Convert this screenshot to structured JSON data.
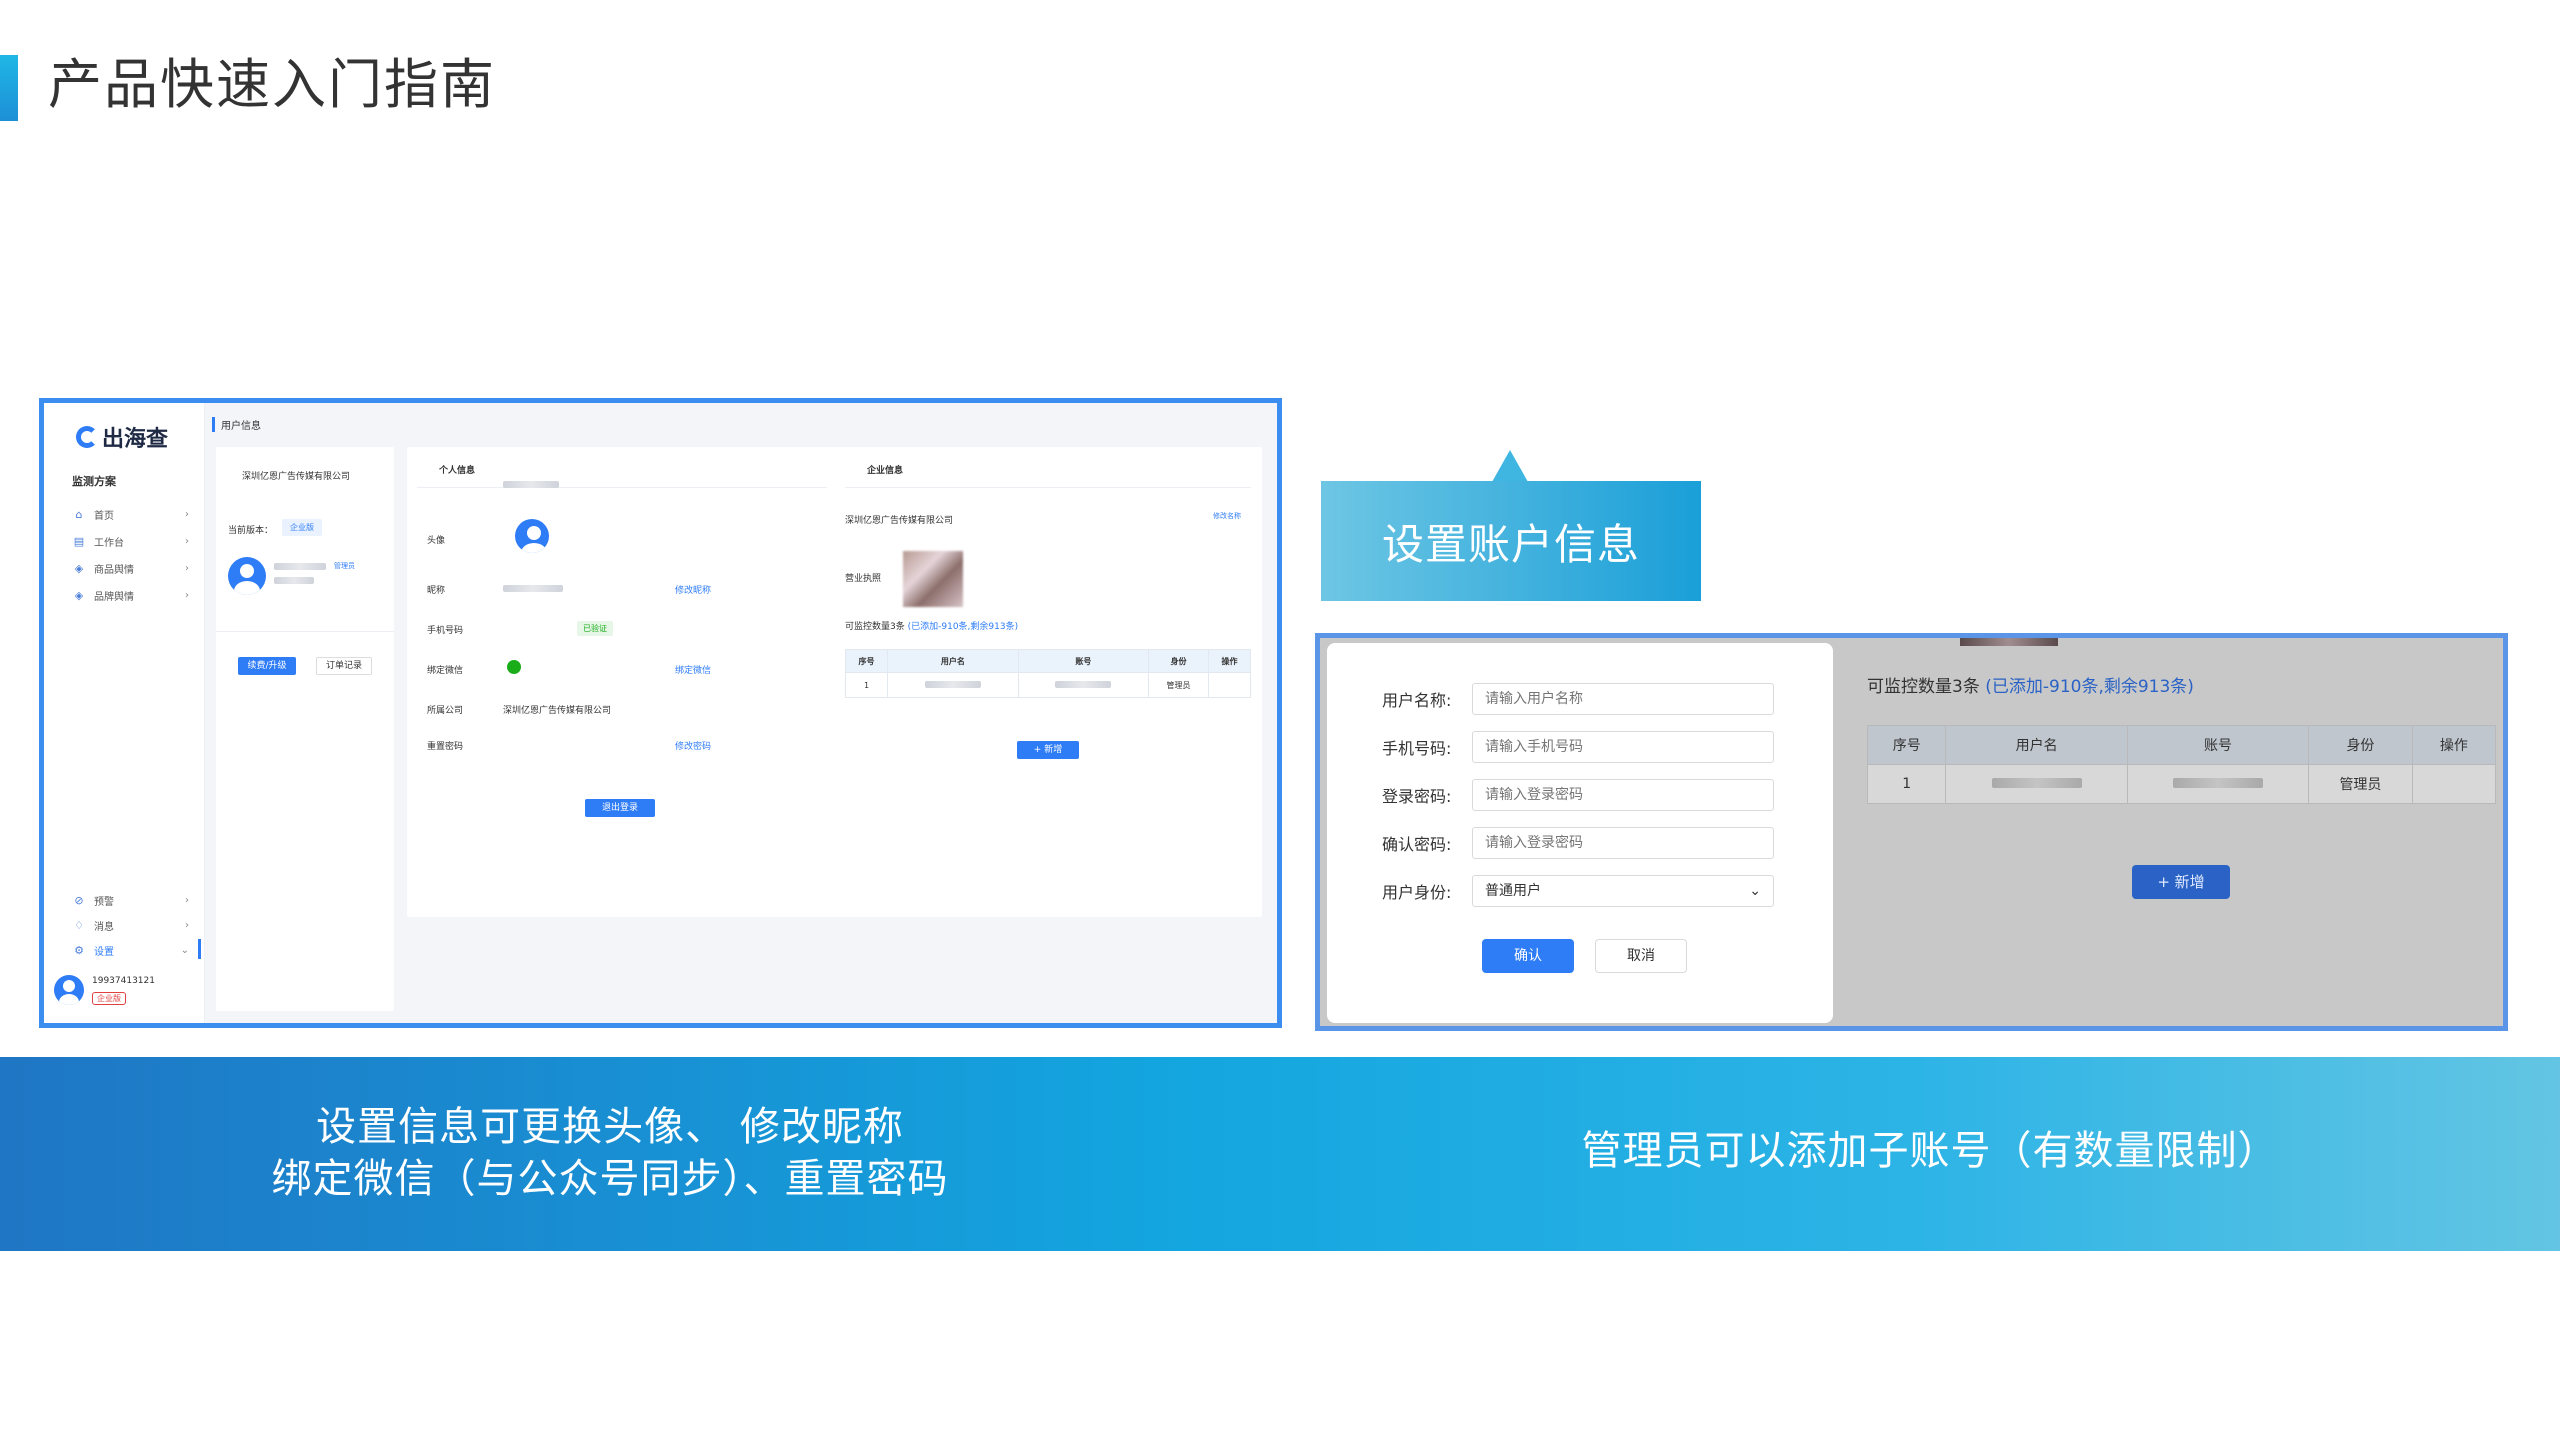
{
  "slide": {
    "title": "产品快速入门指南",
    "callout": "设置账户信息",
    "caption_left_line1": "设置信息可更换头像、 修改昵称",
    "caption_left_line2": "绑定微信（与公众号同步）、重置密码",
    "caption_right": "管理员可以添加子账号（有数量限制）"
  },
  "left_screenshot": {
    "logo_text": "出海查",
    "sidebar": {
      "section": "监测方案",
      "items": [
        {
          "label": "首页",
          "icon": "home-icon"
        },
        {
          "label": "工作台",
          "icon": "workbench-icon"
        },
        {
          "label": "商品舆情",
          "icon": "layers-icon"
        },
        {
          "label": "品牌舆情",
          "icon": "layers-icon"
        }
      ],
      "bottom_items": [
        {
          "label": "预警",
          "icon": "alarm-icon"
        },
        {
          "label": "消息",
          "icon": "bell-icon"
        },
        {
          "label": "设置",
          "icon": "gear-icon"
        }
      ],
      "user_phone": "19937413121",
      "user_tag": "企业版"
    },
    "breadcrumb": "用户信息",
    "account_card": {
      "company": "深圳亿恩广告传媒有限公司",
      "version_label": "当前版本：",
      "version_value": "企业版",
      "role_badge": "管理员",
      "renew_button": "续费/升级",
      "orders_button": "订单记录"
    },
    "personal": {
      "heading": "个人信息",
      "avatar_label": "头像",
      "nickname_label": "昵称",
      "nickname_action": "修改昵称",
      "phone_label": "手机号码",
      "phone_status": "已验证",
      "wechat_label": "绑定微信",
      "wechat_action": "绑定微信",
      "company_label": "所属公司",
      "company_value": "深圳亿恩广告传媒有限公司",
      "password_label": "重置密码",
      "password_action": "修改密码",
      "logout_button": "退出登录"
    },
    "enterprise": {
      "heading": "企业信息",
      "company_name": "深圳亿恩广告传媒有限公司",
      "rename_action": "修改名称",
      "license_label": "营业执照",
      "quota_text": "可监控数量3条",
      "quota_detail": "(已添加-910条,剩余913条)",
      "table_headers": [
        "序号",
        "用户名",
        "账号",
        "身份",
        "操作"
      ],
      "table_rows": [
        [
          "1",
          "",
          "",
          "管理员",
          ""
        ]
      ],
      "add_button": "+ 新增"
    }
  },
  "right_screenshot": {
    "form": [
      {
        "label": "用户名称:",
        "placeholder": "请输入用户名称"
      },
      {
        "label": "手机号码:",
        "placeholder": "请输入手机号码"
      },
      {
        "label": "登录密码:",
        "placeholder": "请输入登录密码"
      },
      {
        "label": "确认密码:",
        "placeholder": "请输入登录密码"
      }
    ],
    "role_label": "用户身份:",
    "role_value": "普通用户",
    "confirm_button": "确认",
    "cancel_button": "取消",
    "quota_text": "可监控数量3条",
    "quota_detail": "(已添加-910条,剩余913条)",
    "table_headers": [
      "序号",
      "用户名",
      "账号",
      "身份",
      "操作"
    ],
    "table_rows": [
      [
        "1",
        "",
        "",
        "管理员",
        ""
      ]
    ],
    "add_button": "+ 新增"
  },
  "colors": {
    "accent": "#2e7cf6",
    "frame_border": "#3b8ef0",
    "band_start": "#1f76c4",
    "band_end": "#63c5e3"
  }
}
